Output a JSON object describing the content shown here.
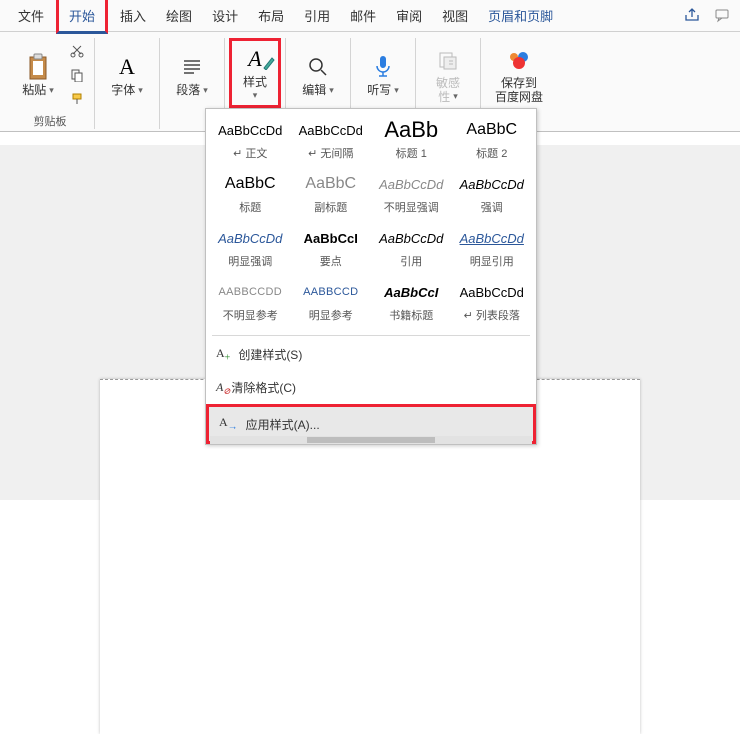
{
  "tabs": {
    "file": "文件",
    "home": "开始",
    "insert": "插入",
    "draw": "绘图",
    "design": "设计",
    "layout": "布局",
    "references": "引用",
    "mail": "邮件",
    "review": "审阅",
    "view": "视图",
    "header_footer": "页眉和页脚"
  },
  "ribbon": {
    "clipboard": {
      "paste": "粘贴",
      "label": "剪贴板"
    },
    "font": {
      "button": "字体"
    },
    "paragraph": {
      "button": "段落"
    },
    "styles": {
      "button": "样式"
    },
    "editing": {
      "button": "编辑"
    },
    "dictate": {
      "button": "听写"
    },
    "sensitivity": {
      "button": "敏感\n性",
      "label_top": "敏感",
      "label_bot": "性"
    },
    "baidu": {
      "line1": "保存到",
      "line2": "百度网盘"
    }
  },
  "style_gallery": [
    {
      "preview": "AaBbCcDd",
      "name": "↵ 正文",
      "cls": ""
    },
    {
      "preview": "AaBbCcDd",
      "name": "↵ 无间隔",
      "cls": ""
    },
    {
      "preview": "AaBb",
      "name": "标题 1",
      "cls": "big"
    },
    {
      "preview": "AaBbC",
      "name": "标题 2",
      "cls": "med"
    },
    {
      "preview": "AaBbC",
      "name": "标题",
      "cls": "med"
    },
    {
      "preview": "AaBbC",
      "name": "副标题",
      "cls": "med gray"
    },
    {
      "preview": "AaBbCcDd",
      "name": "不明显强调",
      "cls": "italic gray"
    },
    {
      "preview": "AaBbCcDd",
      "name": "强调",
      "cls": "italic"
    },
    {
      "preview": "AaBbCcDd",
      "name": "明显强调",
      "cls": "italic blue"
    },
    {
      "preview": "AaBbCcI",
      "name": "要点",
      "cls": "bold"
    },
    {
      "preview": "AaBbCcDd",
      "name": "引用",
      "cls": "italic"
    },
    {
      "preview": "AaBbCcDd",
      "name": "明显引用",
      "cls": "italic blue underline"
    },
    {
      "preview": "AABBCCDD",
      "name": "不明显参考",
      "cls": "small gray"
    },
    {
      "preview": "AABBCCD",
      "name": "明显参考",
      "cls": "small blue"
    },
    {
      "preview": "AaBbCcI",
      "name": "书籍标题",
      "cls": "bolditalic"
    },
    {
      "preview": "AaBbCcDd",
      "name": "↵ 列表段落",
      "cls": ""
    }
  ],
  "dropdown": {
    "create": "创建样式(S)",
    "clear": "清除格式(C)",
    "apply": "应用样式(A)..."
  }
}
